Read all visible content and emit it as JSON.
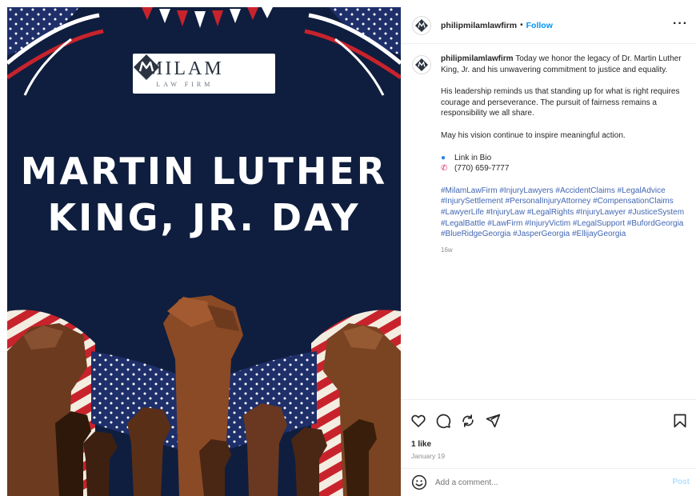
{
  "image": {
    "logo": {
      "main": "MILAM",
      "sub": "LAW FIRM"
    },
    "headline_line1": "MARTIN LUTHER",
    "headline_line2": "KING, JR. DAY"
  },
  "header": {
    "username": "philipmilamlawfirm",
    "dot": "•",
    "follow_label": "Follow",
    "more_label": "···"
  },
  "caption": {
    "username": "philipmilamlawfirm",
    "text1": "Today we honor the legacy of Dr. Martin Luther King, Jr. and his unwavering commitment to justice and equality.",
    "text2": "His leadership reminds us that standing up for what is right requires courage and perseverance. The pursuit of fairness remains a responsibility we all share.",
    "text3": "May his vision continue to inspire meaningful action.",
    "link_label": "Link in Bio",
    "phone": "(770) 659-7777",
    "hashtags": [
      "#MilamLawFirm",
      "#InjuryLawyers",
      "#AccidentClaims",
      "#LegalAdvice",
      "#InjurySettlement",
      "#PersonalInjuryAttorney",
      "#CompensationClaims",
      "#LawyerLife",
      "#InjuryLaw",
      "#LegalRights",
      "#InjuryLawyer",
      "#JusticeSystem",
      "#LegalBattle",
      "#LawFirm",
      "#InjuryVictim",
      "#LegalSupport",
      "#BufordGeorgia",
      "#BlueRidgeGeorgia",
      "#JasperGeorgia",
      "#EllijayGeorgia"
    ],
    "time_ago": "16w"
  },
  "actions": {
    "icons": [
      "heart-icon",
      "comment-icon",
      "share-icon",
      "send-icon",
      "bookmark-icon"
    ],
    "likes": "1 like",
    "date": "January 19"
  },
  "comment": {
    "placeholder": "Add a comment...",
    "post_label": "Post"
  },
  "colors": {
    "navy": "#0f1e3e",
    "link_blue": "#0095f6",
    "hashtag_blue": "#4267b2"
  }
}
